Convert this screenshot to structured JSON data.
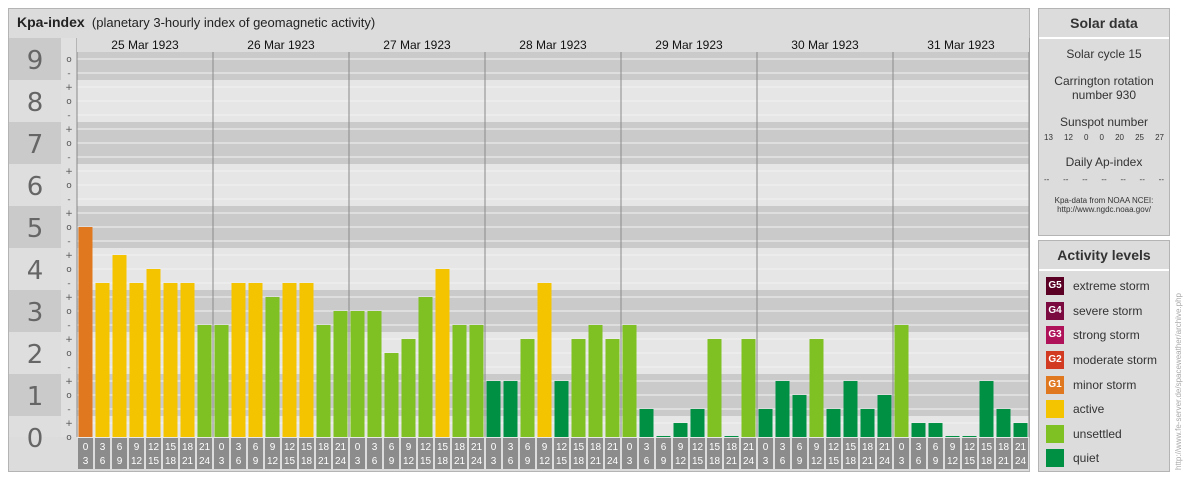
{
  "title": {
    "main": "Kpa-index",
    "sub": "(planetary 3-hourly index of geomagnetic activity)"
  },
  "chart_data": {
    "type": "bar",
    "title": "Kpa-index (planetary 3-hourly index of geomagnetic activity)",
    "ylim": [
      0,
      9
    ],
    "y_ticks": [
      "0",
      "1",
      "2",
      "3",
      "4",
      "5",
      "6",
      "7",
      "8",
      "9"
    ],
    "y_subticks": [
      "o",
      "+",
      "-"
    ],
    "days": [
      "25 Mar 1923",
      "26 Mar 1923",
      "27 Mar 1923",
      "28 Mar 1923",
      "29 Mar 1923",
      "30 Mar 1923",
      "31 Mar 1923"
    ],
    "slot_labels_top": [
      "0",
      "3",
      "6",
      "9",
      "12",
      "15",
      "18",
      "21"
    ],
    "slot_labels_bottom": [
      "3",
      "6",
      "9",
      "12",
      "15",
      "18",
      "21",
      "24"
    ],
    "values": [
      5.0,
      3.667,
      4.333,
      3.667,
      4.0,
      3.667,
      3.667,
      2.667,
      2.667,
      3.667,
      3.667,
      3.333,
      3.667,
      3.667,
      2.667,
      3.0,
      3.0,
      3.0,
      2.0,
      2.333,
      3.333,
      4.0,
      2.667,
      2.667,
      1.333,
      1.333,
      2.333,
      3.667,
      1.333,
      2.333,
      2.667,
      2.333,
      2.667,
      0.667,
      0.0,
      0.333,
      0.667,
      2.333,
      0.0,
      2.333,
      0.667,
      1.333,
      1.0,
      2.333,
      0.667,
      1.333,
      0.667,
      1.0,
      2.667,
      0.333,
      0.333,
      0.0,
      0.0,
      1.333,
      0.667,
      0.333
    ],
    "level_colors": {
      "G1": "#e07820",
      "active": "#f5c400",
      "unsettled": "#7fc023",
      "quiet": "#009044"
    }
  },
  "solar": {
    "title": "Solar data",
    "cycle": "Solar cycle 15",
    "carrington_line1": "Carrington rotation",
    "carrington_line2": "number 930",
    "sunspot_title": "Sunspot number",
    "sunspots": [
      "13",
      "12",
      "0",
      "0",
      "20",
      "25",
      "27"
    ],
    "ap_title": "Daily Ap-index",
    "ap": [
      "--",
      "--",
      "--",
      "--",
      "--",
      "--",
      "--"
    ],
    "source_line1": "Kpa-data from NOAA NCEI:",
    "source_line2": "http://www.ngdc.noaa.gov/"
  },
  "activity": {
    "title": "Activity levels",
    "levels": [
      {
        "badge": "G5",
        "label": "extreme storm",
        "color": "#5a0025"
      },
      {
        "badge": "G4",
        "label": "severe storm",
        "color": "#7a0a40"
      },
      {
        "badge": "G3",
        "label": "strong storm",
        "color": "#b0125a"
      },
      {
        "badge": "G2",
        "label": "moderate storm",
        "color": "#d33a22"
      },
      {
        "badge": "G1",
        "label": "minor storm",
        "color": "#e07820"
      },
      {
        "badge": "",
        "label": "active",
        "color": "#f5c400"
      },
      {
        "badge": "",
        "label": "unsettled",
        "color": "#7fc023"
      },
      {
        "badge": "",
        "label": "quiet",
        "color": "#009044"
      }
    ]
  },
  "credit": "http://www.fe-server.de/spaceweather/archive.php"
}
